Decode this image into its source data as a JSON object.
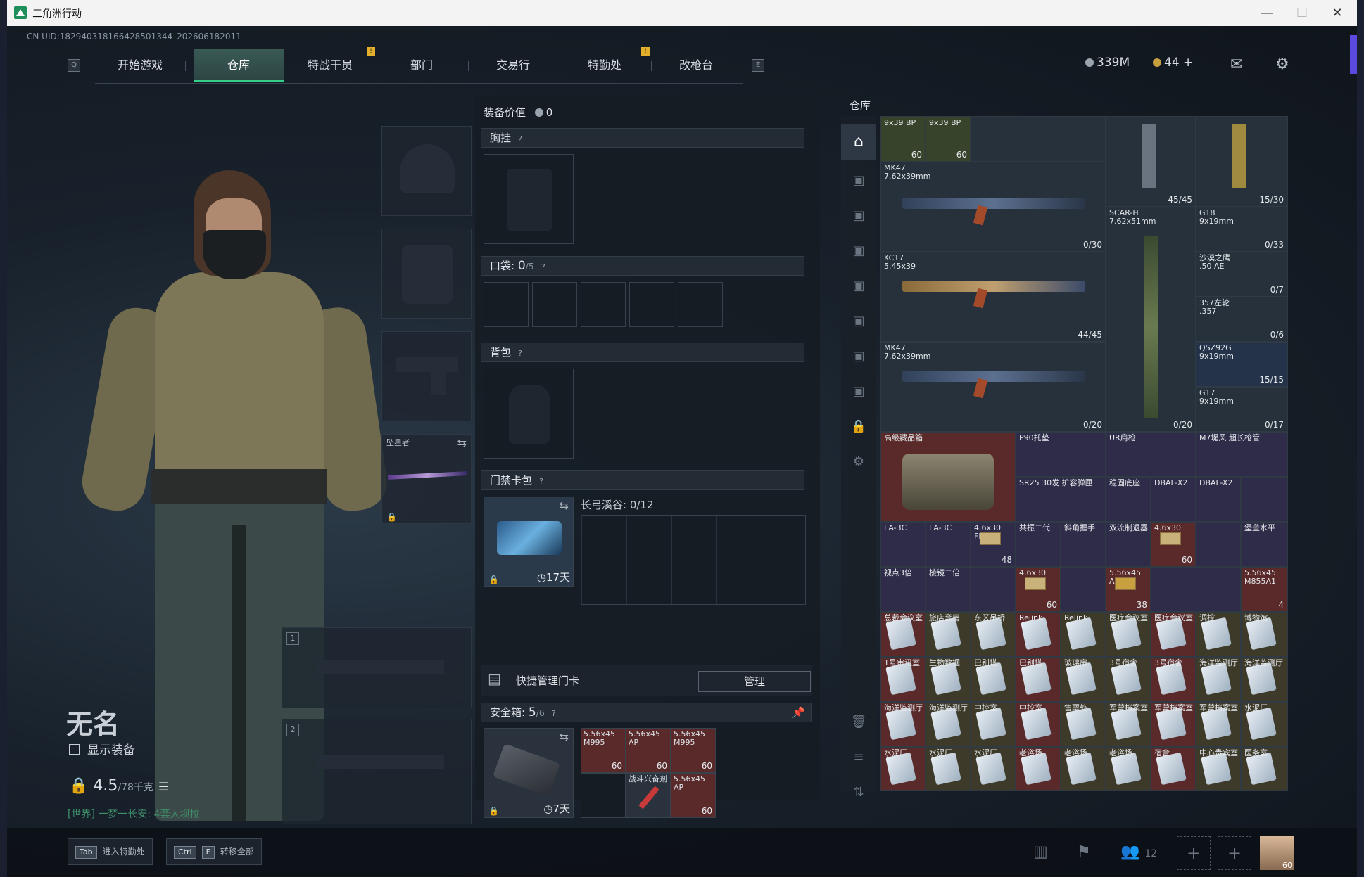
{
  "window": {
    "title": "三角洲行动"
  },
  "uid": "CN UID:182940318166428501344_202606182011",
  "nav": {
    "left_key": "Q",
    "right_key": "E",
    "tabs": [
      "开始游戏",
      "仓库",
      "特战干员",
      "部门",
      "交易行",
      "特勤处",
      "改枪台"
    ],
    "active": "仓库",
    "alert_badge": "!"
  },
  "currency": {
    "money": "339M",
    "coins": "44",
    "coins_add": "+"
  },
  "colors": {
    "accent": "#34d08a",
    "alert": "#e2b02a",
    "world_chat": "#3f8f6a"
  },
  "character": {
    "name": "无名",
    "show_equipment": "显示装备",
    "weight": "4.5",
    "weight_max": "/78千克",
    "world_chat": "[世界] 一梦一长安: 4套大坝拉"
  },
  "equip_slots": {
    "melee_label": "坠星者",
    "weapon1": "1",
    "weapon2": "2"
  },
  "middle": {
    "equip_value_label": "装备价值",
    "equip_value": "0",
    "chest_rig": "胸挂",
    "q": "?",
    "pockets": "口袋:",
    "pockets_count": "0",
    "pockets_max": "/5",
    "backpack": "背包",
    "keycard_pack": "门禁卡包",
    "keycard_timer": "17天",
    "keycard_region": "长弓溪谷: 0/12",
    "quick_manage": "快捷管理门卡",
    "manage_button": "管理",
    "safe_box": "安全箱:",
    "safe_box_count": "5",
    "safe_box_max": "/6",
    "safe_timer": "7天",
    "safe_items": [
      {
        "name": "5.56x45 M995",
        "count": "60"
      },
      {
        "name": "5.56x45 AP",
        "count": "60"
      },
      {
        "name": "5.56x45 M995",
        "count": "60"
      },
      {
        "name": "战斗兴奋剂",
        "count": ""
      },
      {
        "name": "5.56x45 AP",
        "count": "60"
      }
    ]
  },
  "warehouse": {
    "title": "仓库",
    "weapons": [
      {
        "name": "MK47\n7.62x39mm",
        "count": "0/30"
      },
      {
        "name": "KC17\n5.45x39",
        "count": "44/45"
      },
      {
        "name": "MK47\n7.62x39mm",
        "count": "0/20"
      },
      {
        "name": "SCAR-H\n7.62x51mm",
        "count": "0/20"
      },
      {
        "name": "G18\n9x19mm",
        "count": "0/33"
      },
      {
        "name": "沙漠之鹰\n.50 AE",
        "count": "0/7"
      },
      {
        "name": "357左轮\n.357",
        "count": "0/6"
      },
      {
        "name": "QSZ92G\n9x19mm",
        "count": "15/15"
      },
      {
        "name": "G17\n9x19mm",
        "count": "0/17"
      }
    ],
    "top_items": [
      {
        "name": "9x39\nBP",
        "count": "60"
      },
      {
        "name": "9x39\nBP",
        "count": "60"
      },
      {
        "count": "45/45"
      },
      {
        "count": "15/30"
      }
    ],
    "attachments": [
      "高级藏品箱",
      "P90托垫",
      "UR肩枪",
      "M7堤风 超长枪管",
      "SR25 30发 扩容弹匣",
      "稳固底座",
      "DBAL-X2",
      "DBAL-X2",
      "LA-3C",
      "LA-3C",
      "4.6x30 FMJ",
      "共振二代",
      "斜角握手",
      "双流制退器",
      "4.6x30",
      "堡垒水平",
      "视点3倍",
      "棱镜二倍",
      "4.6x30",
      "5.56x45 AP",
      "5.56x45 M855A1"
    ],
    "attachment_counts": {
      "r3c3": "48",
      "r3c7": "60",
      "r4c4": "60",
      "r4c6": "38",
      "r4c9": "4"
    },
    "keycards": [
      "总裁会议室",
      "旅店套房",
      "东区吊桥",
      "Relink",
      "Relink",
      "医疗会议室",
      "医疗会议室",
      "调控",
      "博物馆",
      "1号审讯室",
      "生物数据",
      "巴别塔",
      "巴别塔",
      "玻璃房",
      "3号宿舍",
      "3号宿舍",
      "海洋监测厅",
      "海洋监测厅",
      "海洋监测厅",
      "海洋监测厅",
      "中控室",
      "中控室",
      "售票处",
      "军营档案室",
      "军营档案室",
      "军营档案室",
      "水泥厂",
      "水泥厂",
      "水泥厂",
      "水泥厂",
      "老浴场",
      "老浴场",
      "老浴场",
      "宿舍",
      "中心贵宾室",
      "医务室"
    ]
  },
  "bottom": {
    "hint1_key": "Tab",
    "hint1": "进入特勤处",
    "hint2_key1": "Ctrl",
    "hint2_key2": "F",
    "hint2": "转移全部",
    "friends": "12",
    "avatar_level": "60"
  }
}
